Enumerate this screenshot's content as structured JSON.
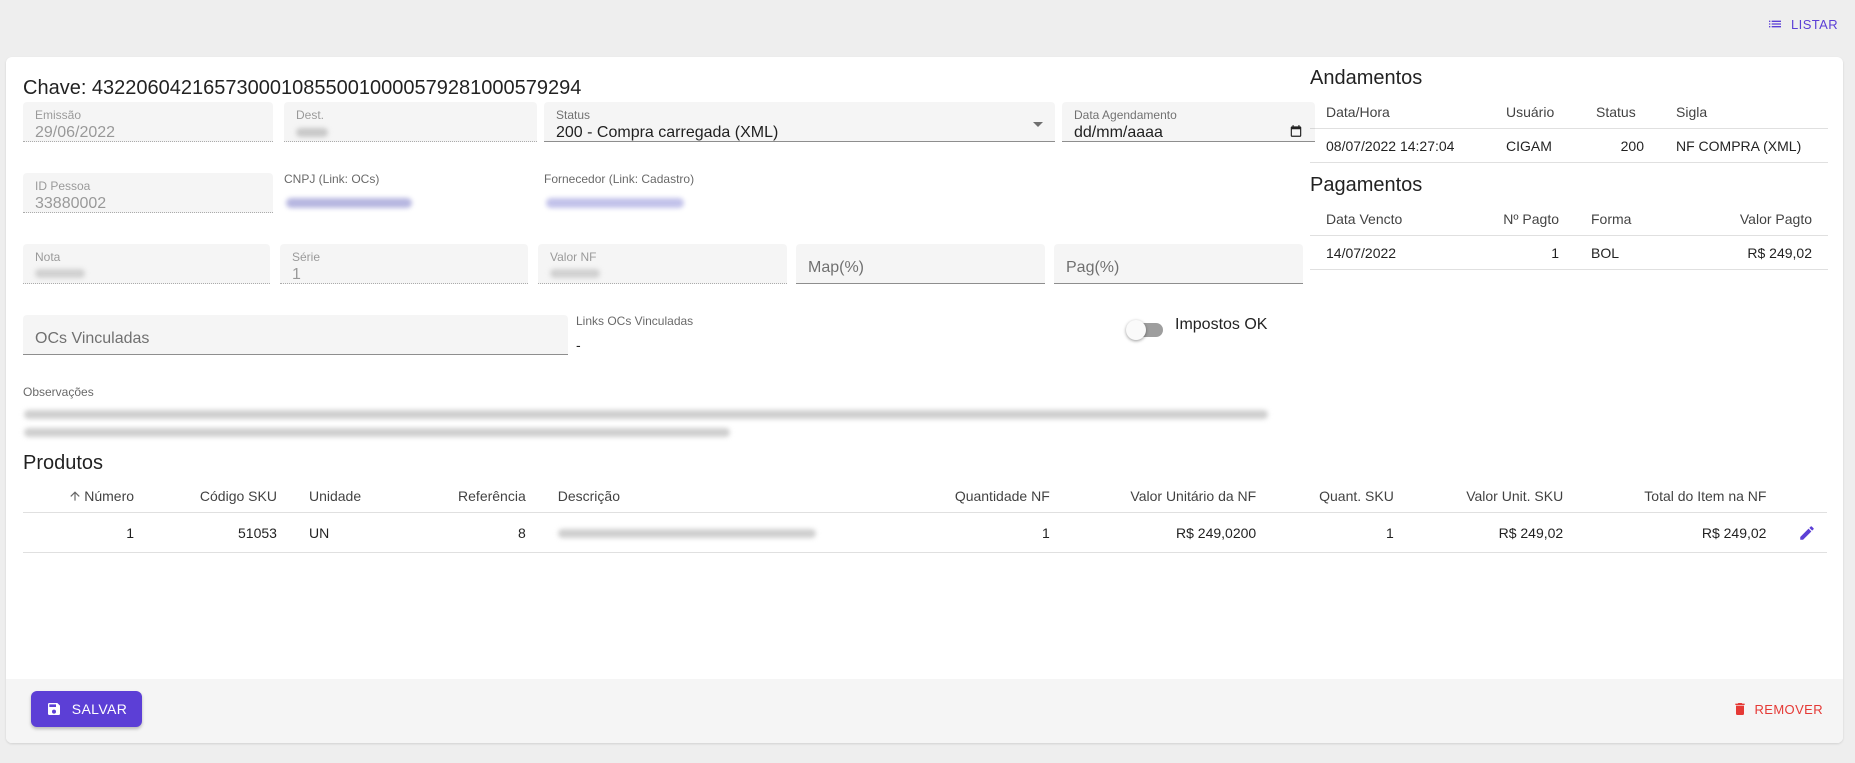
{
  "header": {
    "listar_label": "LISTAR",
    "listar_icon": "list-icon"
  },
  "nota": {
    "chave": "Chave: 43220604216573000108550010000579281000579294",
    "emissao": {
      "label": "Emissão",
      "value": "29/06/2022"
    },
    "dest": {
      "label": "Dest."
    },
    "status": {
      "label": "Status",
      "value": "200 - Compra carregada (XML)"
    },
    "data_agendamento": {
      "label": "Data Agendamento",
      "value": "dd/mm/aaaa"
    },
    "id_pessoa": {
      "label": "ID Pessoa",
      "value": "33880002"
    },
    "cnpj": {
      "label": "CNPJ (Link: OCs)"
    },
    "fornecedor": {
      "label": "Fornecedor (Link: Cadastro)"
    },
    "nota_num": {
      "label": "Nota"
    },
    "serie": {
      "label": "Série",
      "value": "1"
    },
    "valor_nf": {
      "label": "Valor NF"
    },
    "map": {
      "placeholder": "Map(%)"
    },
    "pag": {
      "placeholder": "Pag(%)"
    },
    "ocs_vinculadas": {
      "placeholder": "OCs Vinculadas"
    },
    "links_ocs": {
      "label": "Links OCs Vinculadas",
      "value": "-"
    },
    "impostos_ok": {
      "label": "Impostos OK",
      "checked": false
    },
    "observacoes": {
      "label": "Observações"
    }
  },
  "andamentos": {
    "title": "Andamentos",
    "columns": [
      "Data/Hora",
      "Usuário",
      "Status",
      "Sigla"
    ],
    "rows": [
      [
        "08/07/2022 14:27:04",
        "CIGAM",
        "200",
        "NF COMPRA (XML)"
      ]
    ]
  },
  "pagamentos": {
    "title": "Pagamentos",
    "columns": [
      "Data Vencto",
      "Nº Pagto",
      "Forma",
      "Valor Pagto"
    ],
    "rows": [
      [
        "14/07/2022",
        "1",
        "BOL",
        "R$ 249,02"
      ]
    ]
  },
  "produtos": {
    "title": "Produtos",
    "columns": [
      "Número",
      "Código SKU",
      "Unidade",
      "Referência",
      "Descrição",
      "Quantidade NF",
      "Valor Unitário da NF",
      "Quant. SKU",
      "Valor Unit. SKU",
      "Total do Item na NF"
    ],
    "rows": [
      [
        "1",
        "51053",
        "UN",
        "8",
        "",
        "1",
        "R$ 249,0200",
        "1",
        "R$ 249,02",
        "R$ 249,02"
      ]
    ]
  },
  "footer": {
    "salvar_label": "SALVAR",
    "remover_label": "REMOVER"
  },
  "colors": {
    "primary": "#5c3fd6",
    "danger": "#e53935"
  }
}
